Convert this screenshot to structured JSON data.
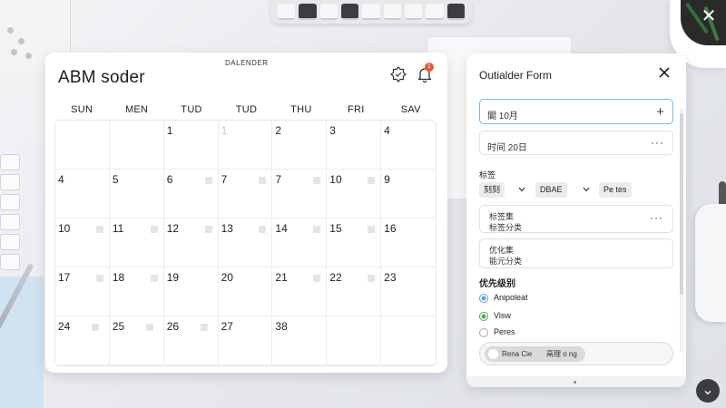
{
  "colors": {
    "accent_blue": "#5fa0d8",
    "accent_green": "#3fb24c",
    "badge_red": "#e25a3a",
    "focus_border": "#7db6dd"
  },
  "calendar": {
    "title": "ABM soder",
    "subtitle": "DALENDER",
    "badge_count": "1",
    "settings_icon": "settings-badge-icon",
    "bell_icon": "bell-icon",
    "weekdays": [
      "SUN",
      "MEN",
      "TUD",
      "TUD",
      "THU",
      "FRI",
      "SAV"
    ],
    "weeks": [
      [
        "",
        "",
        "1",
        "1",
        "2",
        "3",
        "4"
      ],
      [
        "4",
        "5",
        "6",
        "7",
        "7",
        "10",
        "9"
      ],
      [
        "10",
        "11",
        "12",
        "13",
        "14",
        "15",
        "16"
      ],
      [
        "17",
        "18",
        "19",
        "20",
        "21",
        "22",
        "23"
      ],
      [
        "24",
        "25",
        "26",
        "27",
        "38",
        "",
        ""
      ]
    ]
  },
  "form": {
    "title": "Outialder Form",
    "close_icon": "close-icon",
    "field1_value": "閣 10月",
    "field1_action": "+",
    "field2_value": "时间 20日",
    "field2_action": "···",
    "tag_label": "标签",
    "chip1": "刻刻",
    "chip2": "DBAE",
    "chip3": "Pe tes",
    "area1_line1": "标签集",
    "area1_line2": "标签分类",
    "area1_more": "···",
    "area2_line1": "优化集",
    "area2_line2": "能元分类",
    "priority_heading": "优先级别",
    "radio1": "Anipoleat",
    "radio2": "Visw",
    "radio3": "Peres",
    "toggle_left": "Rena Cie",
    "toggle_right": "鬲理 o ng"
  },
  "overlay": {
    "close_glyph": "✕",
    "down_glyph": "⌄"
  }
}
